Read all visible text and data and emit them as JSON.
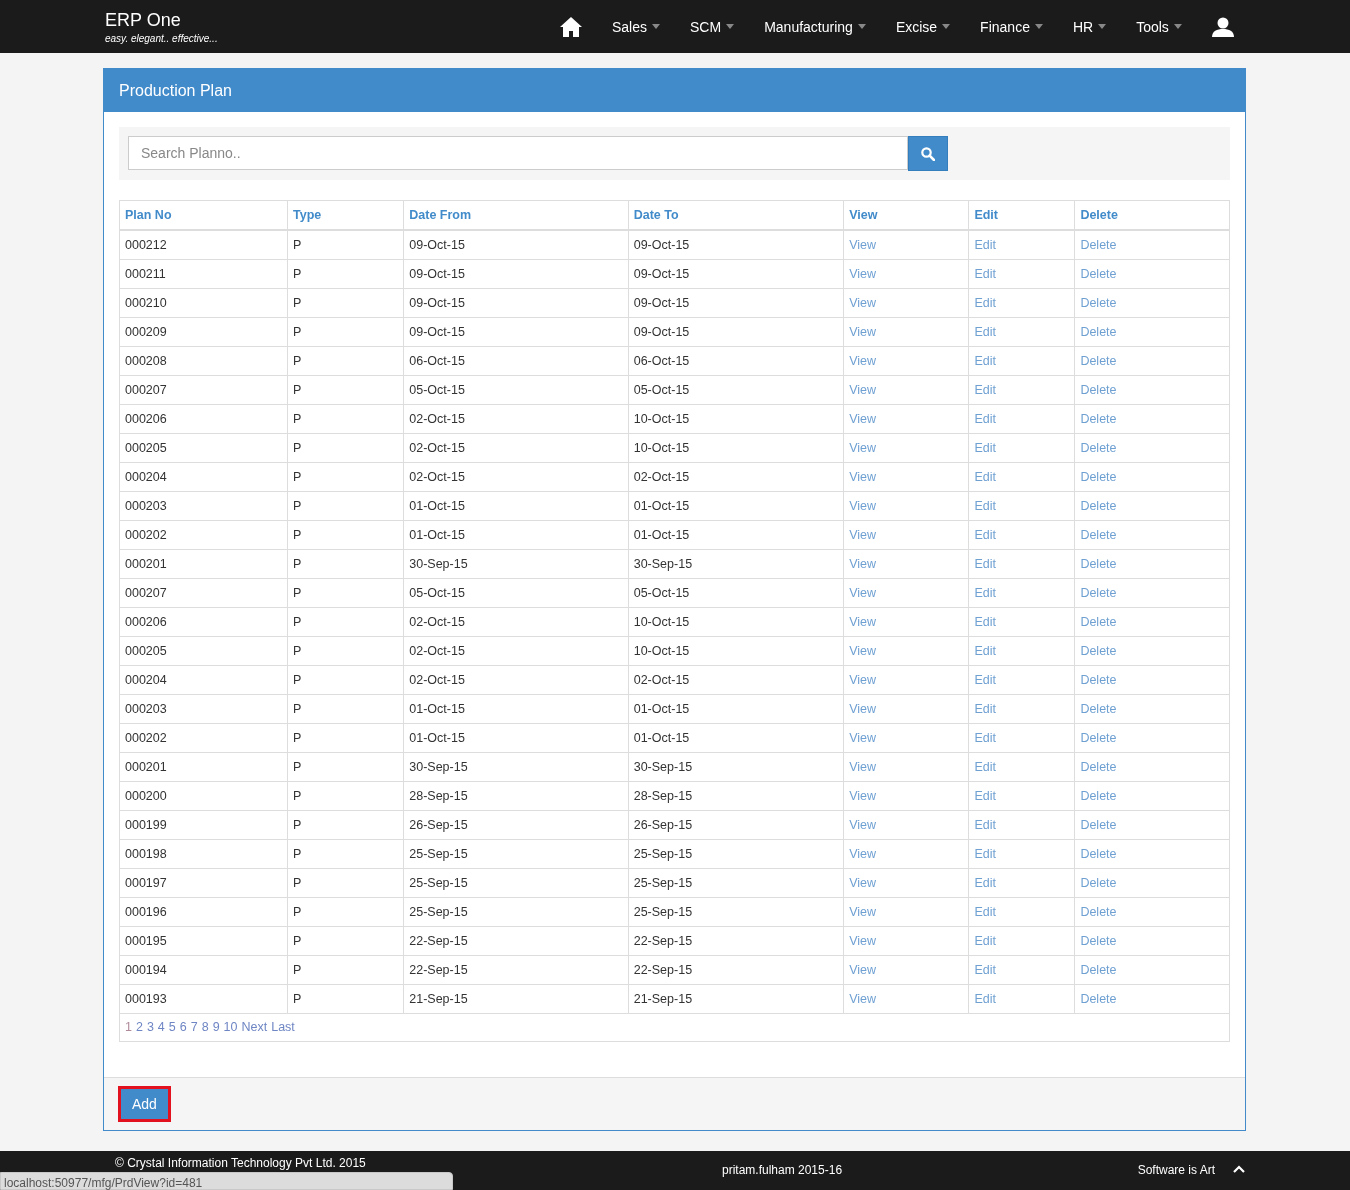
{
  "brand": {
    "title": "ERP One",
    "tagline": "easy. elegant.. effective..."
  },
  "nav": [
    {
      "label": "Sales",
      "dropdown": true
    },
    {
      "label": "SCM",
      "dropdown": true
    },
    {
      "label": "Manufacturing",
      "dropdown": true
    },
    {
      "label": "Excise",
      "dropdown": true
    },
    {
      "label": "Finance",
      "dropdown": true
    },
    {
      "label": "HR",
      "dropdown": true
    },
    {
      "label": "Tools",
      "dropdown": true
    }
  ],
  "panel": {
    "title": "Production Plan"
  },
  "search": {
    "placeholder": "Search Planno.."
  },
  "table": {
    "columns": [
      {
        "label": "Plan No",
        "kind": "text"
      },
      {
        "label": "Type",
        "kind": "text"
      },
      {
        "label": "Date From",
        "kind": "text"
      },
      {
        "label": "Date To",
        "kind": "text"
      },
      {
        "label": "View",
        "kind": "link"
      },
      {
        "label": "Edit",
        "kind": "link"
      },
      {
        "label": "Delete",
        "kind": "link"
      }
    ],
    "rows": [
      {
        "cells": [
          "000212",
          "P",
          "09-Oct-15",
          "09-Oct-15",
          "View",
          "Edit",
          "Delete"
        ]
      },
      {
        "cells": [
          "000211",
          "P",
          "09-Oct-15",
          "09-Oct-15",
          "View",
          "Edit",
          "Delete"
        ]
      },
      {
        "cells": [
          "000210",
          "P",
          "09-Oct-15",
          "09-Oct-15",
          "View",
          "Edit",
          "Delete"
        ]
      },
      {
        "cells": [
          "000209",
          "P",
          "09-Oct-15",
          "09-Oct-15",
          "View",
          "Edit",
          "Delete"
        ]
      },
      {
        "cells": [
          "000208",
          "P",
          "06-Oct-15",
          "06-Oct-15",
          "View",
          "Edit",
          "Delete"
        ]
      },
      {
        "cells": [
          "000207",
          "P",
          "05-Oct-15",
          "05-Oct-15",
          "View",
          "Edit",
          "Delete"
        ]
      },
      {
        "cells": [
          "000206",
          "P",
          "02-Oct-15",
          "10-Oct-15",
          "View",
          "Edit",
          "Delete"
        ]
      },
      {
        "cells": [
          "000205",
          "P",
          "02-Oct-15",
          "10-Oct-15",
          "View",
          "Edit",
          "Delete"
        ]
      },
      {
        "cells": [
          "000204",
          "P",
          "02-Oct-15",
          "02-Oct-15",
          "View",
          "Edit",
          "Delete"
        ]
      },
      {
        "cells": [
          "000203",
          "P",
          "01-Oct-15",
          "01-Oct-15",
          "View",
          "Edit",
          "Delete"
        ]
      },
      {
        "cells": [
          "000202",
          "P",
          "01-Oct-15",
          "01-Oct-15",
          "View",
          "Edit",
          "Delete"
        ]
      },
      {
        "cells": [
          "000201",
          "P",
          "30-Sep-15",
          "30-Sep-15",
          "View",
          "Edit",
          "Delete"
        ]
      },
      {
        "cells": [
          "000207",
          "P",
          "05-Oct-15",
          "05-Oct-15",
          "View",
          "Edit",
          "Delete"
        ]
      },
      {
        "cells": [
          "000206",
          "P",
          "02-Oct-15",
          "10-Oct-15",
          "View",
          "Edit",
          "Delete"
        ]
      },
      {
        "cells": [
          "000205",
          "P",
          "02-Oct-15",
          "10-Oct-15",
          "View",
          "Edit",
          "Delete"
        ]
      },
      {
        "cells": [
          "000204",
          "P",
          "02-Oct-15",
          "02-Oct-15",
          "View",
          "Edit",
          "Delete"
        ]
      },
      {
        "cells": [
          "000203",
          "P",
          "01-Oct-15",
          "01-Oct-15",
          "View",
          "Edit",
          "Delete"
        ]
      },
      {
        "cells": [
          "000202",
          "P",
          "01-Oct-15",
          "01-Oct-15",
          "View",
          "Edit",
          "Delete"
        ]
      },
      {
        "cells": [
          "000201",
          "P",
          "30-Sep-15",
          "30-Sep-15",
          "View",
          "Edit",
          "Delete"
        ]
      },
      {
        "cells": [
          "000200",
          "P",
          "28-Sep-15",
          "28-Sep-15",
          "View",
          "Edit",
          "Delete"
        ]
      },
      {
        "cells": [
          "000199",
          "P",
          "26-Sep-15",
          "26-Sep-15",
          "View",
          "Edit",
          "Delete"
        ]
      },
      {
        "cells": [
          "000198",
          "P",
          "25-Sep-15",
          "25-Sep-15",
          "View",
          "Edit",
          "Delete"
        ]
      },
      {
        "cells": [
          "000197",
          "P",
          "25-Sep-15",
          "25-Sep-15",
          "View",
          "Edit",
          "Delete"
        ]
      },
      {
        "cells": [
          "000196",
          "P",
          "25-Sep-15",
          "25-Sep-15",
          "View",
          "Edit",
          "Delete"
        ]
      },
      {
        "cells": [
          "000195",
          "P",
          "22-Sep-15",
          "22-Sep-15",
          "View",
          "Edit",
          "Delete"
        ]
      },
      {
        "cells": [
          "000194",
          "P",
          "22-Sep-15",
          "22-Sep-15",
          "View",
          "Edit",
          "Delete"
        ]
      },
      {
        "cells": [
          "000193",
          "P",
          "21-Sep-15",
          "21-Sep-15",
          "View",
          "Edit",
          "Delete"
        ]
      }
    ]
  },
  "pagination": [
    {
      "label": "1",
      "selected": true
    },
    {
      "label": "2",
      "selected": false
    },
    {
      "label": "3",
      "selected": false
    },
    {
      "label": "4",
      "selected": false
    },
    {
      "label": "5",
      "selected": false
    },
    {
      "label": "6",
      "selected": false
    },
    {
      "label": "7",
      "selected": false
    },
    {
      "label": "8",
      "selected": false
    },
    {
      "label": "9",
      "selected": false
    },
    {
      "label": "10",
      "selected": false
    },
    {
      "label": "Next",
      "selected": false
    },
    {
      "label": "Last",
      "selected": false
    }
  ],
  "add_button": {
    "label": "Add"
  },
  "footer": {
    "copyright": "© Crystal Information Technology Pvt Ltd. 2015",
    "user": "pritam.fulham 2015-16",
    "motto": "Software is Art"
  },
  "status_bar": {
    "url": "localhost:50977/mfg/PrdView?id=481"
  }
}
